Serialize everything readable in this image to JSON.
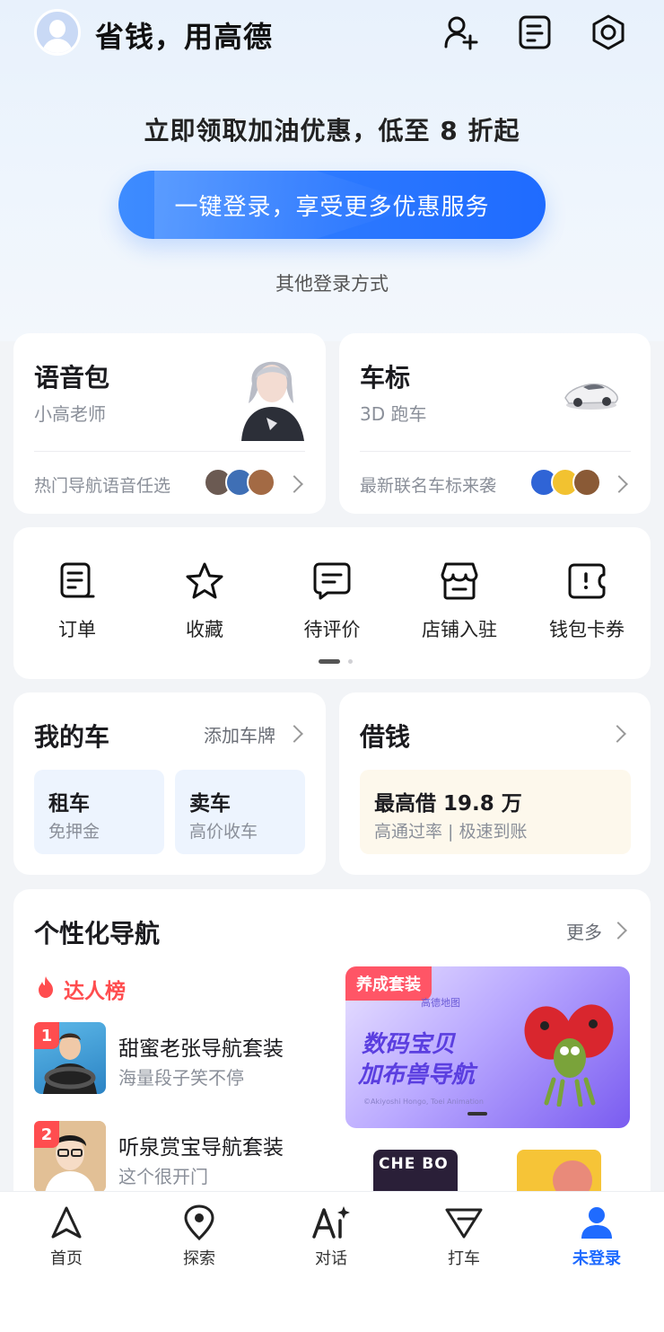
{
  "header": {
    "greeting": "省钱，用高德",
    "icons": [
      "add-user-icon",
      "notes-icon",
      "settings-icon"
    ]
  },
  "login": {
    "promo": "立即领取加油优惠，低至 8 折起",
    "button_label": "一键登录，享受更多优惠服务",
    "other_label": "其他登录方式"
  },
  "voice_pack": {
    "title": "语音包",
    "subtitle": "小高老师",
    "footer": "热门导航语音任选"
  },
  "car_logo": {
    "title": "车标",
    "subtitle": "3D 跑车",
    "footer": "最新联名车标来袭"
  },
  "shortcuts": [
    {
      "label": "订单",
      "icon": "order-icon"
    },
    {
      "label": "收藏",
      "icon": "star-icon"
    },
    {
      "label": "待评价",
      "icon": "comment-icon"
    },
    {
      "label": "店铺入驻",
      "icon": "store-icon"
    },
    {
      "label": "钱包卡券",
      "icon": "wallet-icon"
    }
  ],
  "my_car": {
    "title": "我的车",
    "action": "添加车牌",
    "tiles": [
      {
        "title": "租车",
        "sub": "免押金"
      },
      {
        "title": "卖车",
        "sub": "高价收车"
      }
    ]
  },
  "loan": {
    "title": "借钱",
    "headline": "最高借 19.8 万",
    "sub": "高通过率 | 极速到账"
  },
  "nav": {
    "title": "个性化导航",
    "more": "更多",
    "leaderboard_title": "达人榜",
    "ranks": [
      {
        "rank": "1",
        "title": "甜蜜老张导航套装",
        "sub": "海量段子笑不停"
      },
      {
        "rank": "2",
        "title": "听泉赏宝导航套装",
        "sub": "这个很开门"
      }
    ],
    "banner": {
      "tag": "养成套装",
      "line1": "数码宝贝",
      "line2": "加布兽导航",
      "copyright": "©Akiyoshi Hongo, Toei Animation",
      "brand": "高德地图"
    }
  },
  "tabs": [
    {
      "label": "首页",
      "icon": "navigation-arrow-icon"
    },
    {
      "label": "探索",
      "icon": "location-pin-icon"
    },
    {
      "label": "对话",
      "icon": "ai-icon"
    },
    {
      "label": "打车",
      "icon": "taxi-icon"
    },
    {
      "label": "未登录",
      "icon": "user-icon",
      "active": true
    }
  ],
  "colors": {
    "accent": "#1f6bff",
    "hot": "#ff4d4f"
  }
}
